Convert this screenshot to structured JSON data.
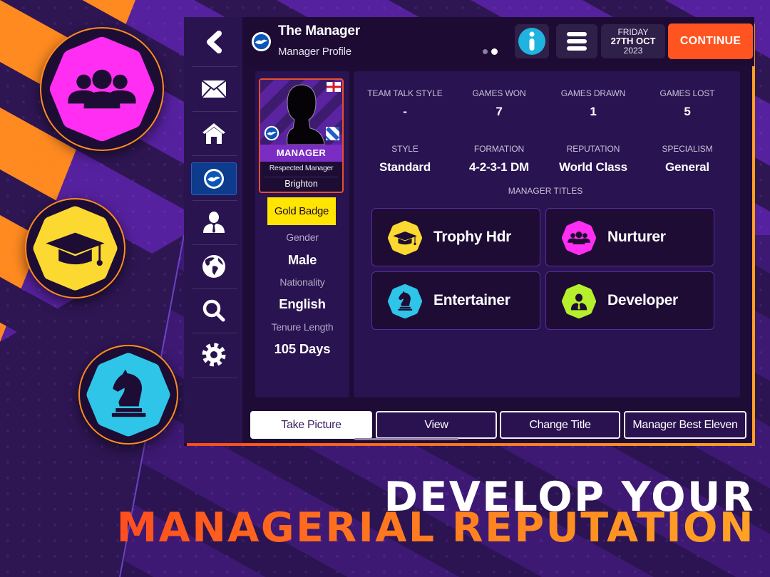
{
  "header": {
    "title": "The Manager",
    "subtitle": "Manager Profile",
    "club_logo_icon": "brighton-crest-icon",
    "page_indicator": {
      "count": 2,
      "active": 2
    },
    "info_icon": "info-icon",
    "menu_icon": "hamburger-menu-icon",
    "date": {
      "day": "FRIDAY",
      "date": "27TH OCT",
      "year": "2023"
    },
    "continue_label": "CONTINUE"
  },
  "sidebar": {
    "items": [
      {
        "id": "back",
        "icon": "chevron-left-icon"
      },
      {
        "id": "inbox",
        "icon": "mail-icon"
      },
      {
        "id": "home",
        "icon": "home-icon"
      },
      {
        "id": "club",
        "icon": "brighton-crest-icon",
        "active": true
      },
      {
        "id": "manager",
        "icon": "person-tie-icon"
      },
      {
        "id": "world",
        "icon": "globe-icon"
      },
      {
        "id": "search",
        "icon": "search-icon"
      },
      {
        "id": "settings",
        "icon": "gear-icon"
      }
    ]
  },
  "profile": {
    "card": {
      "role": "MANAGER",
      "reputation_title": "Respected Manager",
      "club": "Brighton",
      "flag": "England",
      "club_badge_icon": "brighton-crest-icon",
      "kit_icon": "kit-icon"
    },
    "badge": "Gold Badge",
    "fields": [
      {
        "label": "Gender",
        "value": "Male"
      },
      {
        "label": "Nationality",
        "value": "English"
      },
      {
        "label": "Tenure Length",
        "value": "105 Days"
      }
    ]
  },
  "stats": [
    {
      "label": "TEAM TALK STYLE",
      "value": "-"
    },
    {
      "label": "GAMES WON",
      "value": "7"
    },
    {
      "label": "GAMES DRAWN",
      "value": "1"
    },
    {
      "label": "GAMES LOST",
      "value": "5"
    },
    {
      "label": "STYLE",
      "value": "Standard"
    },
    {
      "label": "FORMATION",
      "value": "4-2-3-1 DM"
    },
    {
      "label": "REPUTATION",
      "value": "World Class"
    },
    {
      "label": "SPECIALISM",
      "value": "General"
    }
  ],
  "titles": {
    "heading": "MANAGER TITLES",
    "items": [
      {
        "label": "Trophy Hdr",
        "icon": "graduation-cap-icon",
        "color": "#fbd930"
      },
      {
        "label": "Nurturer",
        "icon": "people-group-icon",
        "color": "#ff2ef2"
      },
      {
        "label": "Entertainer",
        "icon": "chess-knight-icon",
        "color": "#2ec5e8"
      },
      {
        "label": "Developer",
        "icon": "person-tie-icon",
        "color": "#b6ef2c"
      }
    ]
  },
  "actions": [
    {
      "label": "Take Picture",
      "primary": true
    },
    {
      "label": "View"
    },
    {
      "label": "Change Title"
    },
    {
      "label": "Manager Best Eleven"
    }
  ],
  "promo": {
    "line1": "DEVELOP YOUR",
    "line2": "MANAGERIAL REPUTATION",
    "badges": [
      {
        "icon": "people-group-icon",
        "color": "#ff2ef2"
      },
      {
        "icon": "graduation-cap-icon",
        "color": "#fbd930"
      },
      {
        "icon": "chess-knight-icon",
        "color": "#2ec5e8"
      }
    ]
  },
  "colors": {
    "accent_continue": "#ff5420",
    "gold_badge": "#ffe500",
    "frame_orange": "#ffa020",
    "card_border": "#e8502a",
    "sidebar_active": "#0d3c8c",
    "info_cyan": "#1fb4e0"
  }
}
